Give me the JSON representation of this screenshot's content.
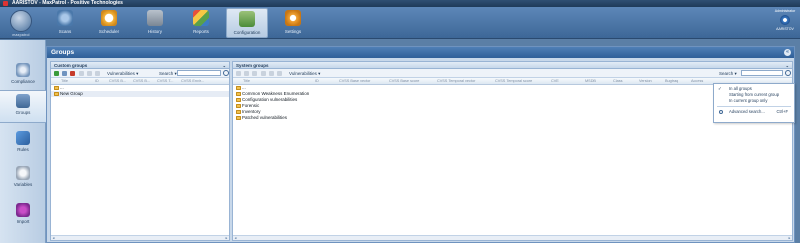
{
  "window": {
    "title": "AARISTOV - MaxPatrol - Positive Technologies"
  },
  "brand": {
    "logo_caption": "maxpatrol"
  },
  "nav": {
    "scans": "Scans",
    "scheduler": "Scheduler",
    "history": "History",
    "reports": "Reports",
    "configuration": "Configuration",
    "settings": "Settings"
  },
  "user": {
    "role": "Administrator",
    "name": "AARISTOV"
  },
  "rail": {
    "compliance": "Compliance",
    "groups": "Groups",
    "rules": "Rules",
    "variables": "Variables",
    "import": "Import"
  },
  "page": {
    "title": "Groups"
  },
  "custom": {
    "title": "Custom groups",
    "filter": "Vulnerabilities",
    "search_label": "Search",
    "search_value": "",
    "columns": [
      "Title",
      "ID",
      "CVSS B...",
      "CVSS B...",
      "CVSS T...",
      "CVSS Envir..."
    ],
    "rows": [
      "...",
      "New Group"
    ]
  },
  "system": {
    "title": "System groups",
    "filter": "Vulnerabilities",
    "search_label": "Search",
    "search_value": "",
    "columns": [
      "Title",
      "ID",
      "CVSS Base vector",
      "CVSS Base score",
      "CVSS Temporal vector",
      "CVSS Temporal score",
      "CVE",
      "MSDB",
      "Class",
      "Version",
      "Bugtraq",
      "Access"
    ],
    "rows": [
      "...",
      "Common Weakness Enumeration",
      "Configuration vulnerabilities",
      "Forensic",
      "Inventory",
      "Patched vulnerabilities"
    ]
  },
  "search_menu": {
    "all_groups": "In all groups",
    "from_current": "Starting from current group",
    "current_only": "In current group only",
    "advanced": "Advanced search...",
    "shortcut": "Ctrl+F"
  }
}
